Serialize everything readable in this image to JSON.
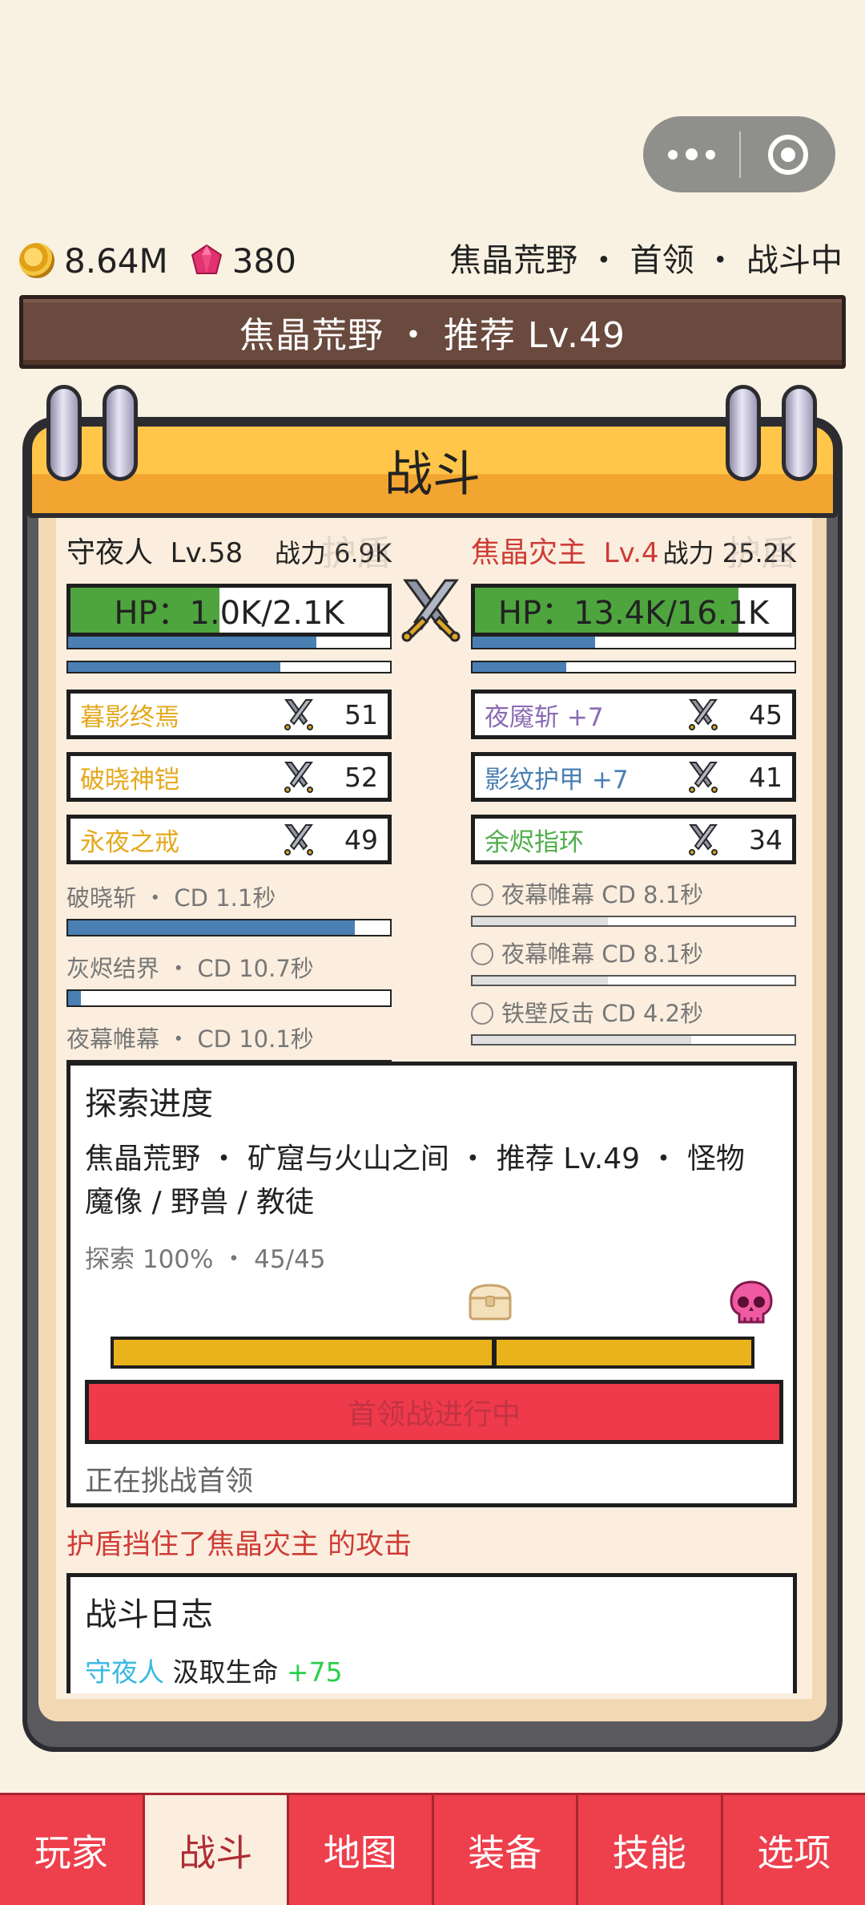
{
  "currency": {
    "gold": "8.64M",
    "gems": "380"
  },
  "location_status": "焦晶荒野 ・ 首领 ・ 战斗中",
  "zone_banner": "焦晶荒野 ・ 推荐 Lv.49",
  "panel_title": "战斗",
  "player": {
    "name": "守夜人",
    "level": "Lv.58",
    "power": "战力 6.9K",
    "shield_label": "护盾",
    "hp": "HP：1.0K/2.1K",
    "hp_fraction": 0.47,
    "bar1_fraction": 0.77,
    "bar2_fraction": 0.66,
    "equipment": [
      {
        "name": "暮影终焉",
        "value": "51",
        "color": "#e5a81c"
      },
      {
        "name": "破晓神铠",
        "value": "52",
        "color": "#e5a81c"
      },
      {
        "name": "永夜之戒",
        "value": "49",
        "color": "#e5a81c"
      }
    ],
    "skills": [
      {
        "label": "破晓斩 ・ CD 1.1秒",
        "fraction": 0.89
      },
      {
        "label": "灰烬结界 ・ CD 10.7秒",
        "fraction": 0.04
      },
      {
        "label": "夜幕帷幕 ・ CD 10.1秒",
        "fraction": 0.22
      }
    ]
  },
  "enemy": {
    "name": "焦晶灾主",
    "level": "Lv.4",
    "power": "战力 25.2K",
    "shield_label": "护盾",
    "hp": "HP：13.4K/16.1K",
    "hp_fraction": 0.83,
    "bar1_fraction": 0.38,
    "bar2_fraction": 0.29,
    "equipment": [
      {
        "name": "夜魇斩 +7",
        "value": "45",
        "color": "#8a6bb3"
      },
      {
        "name": "影纹护甲 +7",
        "value": "41",
        "color": "#4a7fb4"
      },
      {
        "name": "余烬指环",
        "value": "34",
        "color": "#4fae4a"
      }
    ],
    "skills": [
      {
        "label": "夜幕帷幕  CD 8.1秒",
        "fraction": 0.42
      },
      {
        "label": "夜幕帷幕  CD 8.1秒",
        "fraction": 0.42
      },
      {
        "label": "铁壁反击  CD 4.2秒",
        "fraction": 0.68
      }
    ]
  },
  "explore": {
    "title": "探索进度",
    "description": "焦晶荒野 ・ 矿窟与火山之间 ・ 推荐 Lv.49 ・ 怪物 魔像 / 野兽 / 教徒",
    "progress_text": "探索 100% ・ 45/45",
    "progress_fraction": 1.0,
    "boss_button": "首领战进行中",
    "note": "正在挑战首领"
  },
  "shield_message": "护盾挡住了焦晶灾主 的攻击",
  "log": {
    "title": "战斗日志",
    "entry_actor": "守夜人",
    "entry_action": " 汲取生命 ",
    "entry_value": "+75"
  },
  "tabs": [
    "玩家",
    "战斗",
    "地图",
    "装备",
    "技能",
    "选项"
  ],
  "active_tab": 1
}
